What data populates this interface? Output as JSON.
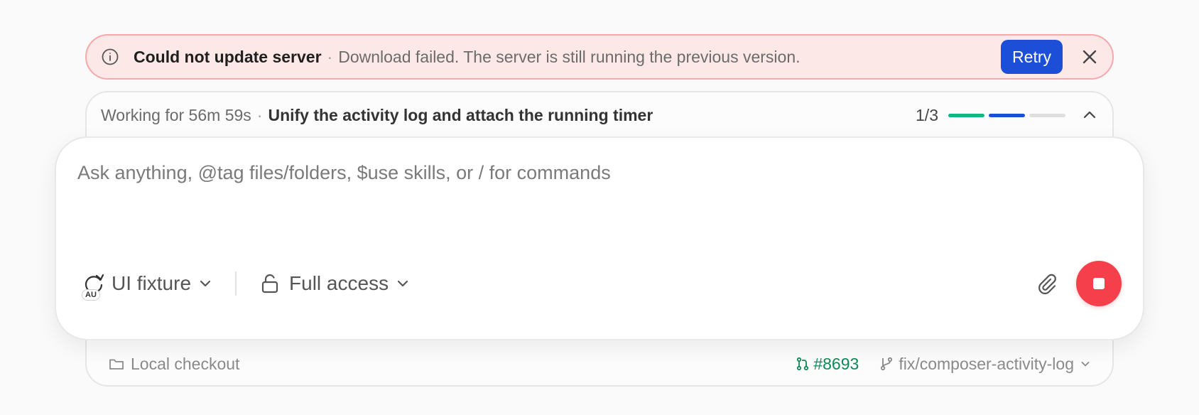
{
  "banner": {
    "title": "Could not update server",
    "separator": "·",
    "message": "Download failed. The server is still running the previous version.",
    "retry_label": "Retry",
    "icons": {
      "info": "info-icon",
      "close": "close-icon"
    }
  },
  "task": {
    "working": "Working for 56m 59s",
    "separator": "·",
    "title": "Unify the activity log and attach the running timer",
    "count": "1/3",
    "progress_segments": [
      "#10b981",
      "#1d4ed8",
      "#dedede"
    ],
    "icons": {
      "collapse": "chevron-up-icon"
    }
  },
  "composer": {
    "placeholder": "Ask anything, @tag files/folders, $use skills, or / for commands",
    "model_label": "UI fixture",
    "model_badge": "AU",
    "access_label": "Full access",
    "icons": {
      "model": "model-icon",
      "access": "unlock-icon",
      "attach": "paperclip-icon",
      "stop": "stop-icon"
    }
  },
  "footer": {
    "location": "Local checkout",
    "pr": "#8693",
    "branch": "fix/composer-activity-log",
    "icons": {
      "folder": "folder-icon",
      "pr": "pull-request-icon",
      "branch": "branch-icon"
    }
  },
  "colors": {
    "accent": "#1d4ed8",
    "error_bg": "#fde8e8",
    "error_border": "#f5a9a9",
    "success": "#10b981",
    "pr_green": "#0f8a55",
    "stop_red": "#f53f4a"
  }
}
